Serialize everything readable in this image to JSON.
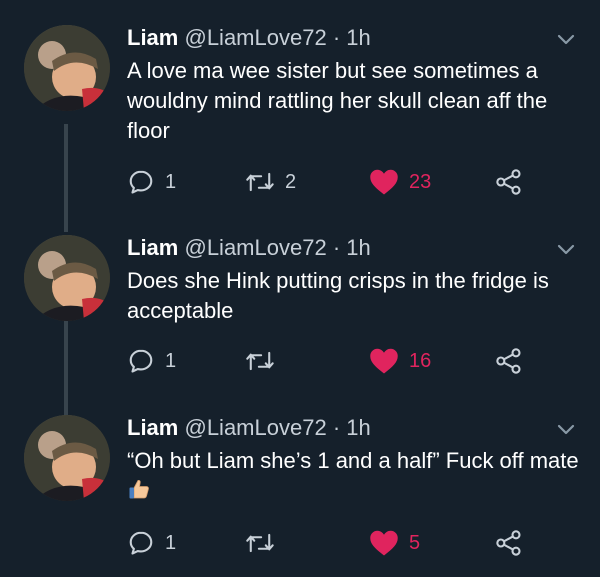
{
  "colors": {
    "background": "#15202b",
    "text": "#ffffff",
    "secondary_text": "#c8d0d8",
    "like": "#e0245e",
    "thread_line": "#38444d"
  },
  "icons": {
    "reply": "reply-icon",
    "retweet": "retweet-icon",
    "like": "heart-icon",
    "share": "share-icon",
    "more": "chevron-down-icon",
    "emoji": "thumbs-up-emoji"
  },
  "tweets": [
    {
      "name": "Liam",
      "handle": "@LiamLove72",
      "separator": "·",
      "time": "1h",
      "text": "A love ma wee sister but see sometimes a wouldny mind rattling her skull clean aff the floor",
      "replies": "1",
      "retweets": "2",
      "likes": "23"
    },
    {
      "name": "Liam",
      "handle": "@LiamLove72",
      "separator": "·",
      "time": "1h",
      "text": "Does she Hink putting crisps in the fridge is acceptable",
      "replies": "1",
      "retweets": "",
      "likes": "16"
    },
    {
      "name": "Liam",
      "handle": "@LiamLove72",
      "separator": "·",
      "time": "1h",
      "text": "“Oh but Liam she’s 1 and a half” Fuck off mate",
      "emoji": "👍",
      "replies": "1",
      "retweets": "",
      "likes": "5"
    }
  ]
}
